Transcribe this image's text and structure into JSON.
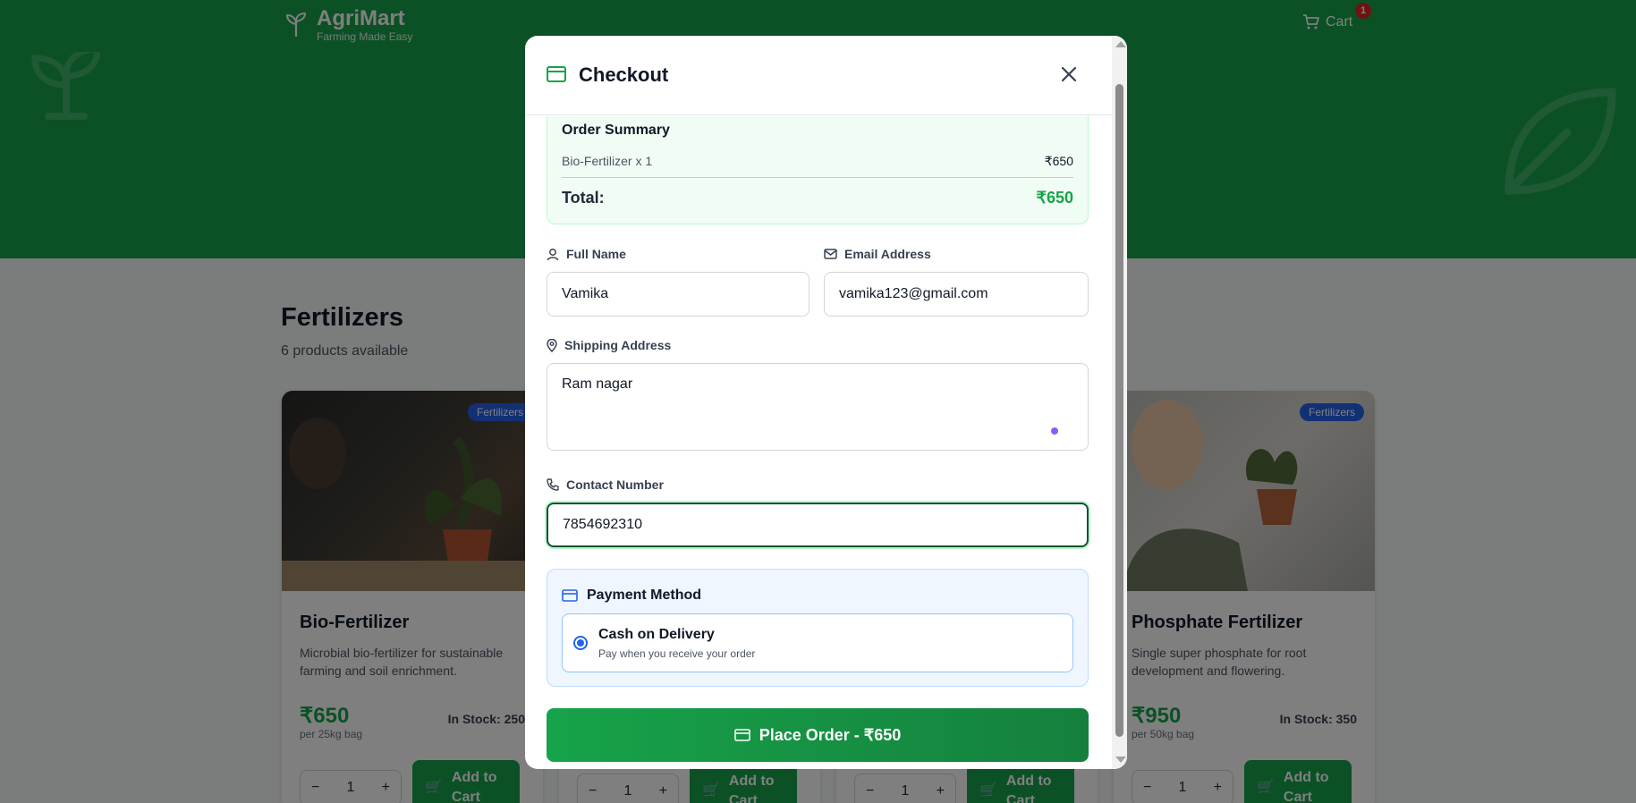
{
  "brand": {
    "name": "AgriMart",
    "tagline": "Farming Made Easy"
  },
  "header": {
    "cart_label": "Cart",
    "cart_count": "1"
  },
  "category": {
    "title": "Fertilizers",
    "count_text": "6 products available"
  },
  "products": [
    {
      "badge": "Fertilizers",
      "name": "Bio-Fertilizer",
      "description": "Microbial bio-fertilizer for sustainable farming and soil enrichment.",
      "price": "₹650",
      "unit": "per 25kg bag",
      "stock": "In Stock: 250",
      "qty": "1",
      "add_label": "Add to Cart"
    },
    {
      "badge": "Fertilizers",
      "name": "Phosphate Fertilizer",
      "description": "Single super phosphate for root development and flowering.",
      "price": "₹950",
      "unit": "per 50kg bag",
      "stock": "In Stock: 350",
      "qty": "1",
      "add_label": "Add to Cart"
    }
  ],
  "hidden_cards": [
    {
      "qty": "1",
      "add_label": "Add to Cart"
    },
    {
      "qty": "1",
      "add_label": "Add to Cart"
    }
  ],
  "checkout": {
    "title": "Checkout",
    "summary": {
      "title": "Order Summary",
      "item": "Bio-Fertilizer x 1",
      "item_price": "₹650",
      "total_label": "Total:",
      "total_amount": "₹650"
    },
    "full_name": {
      "label": "Full Name",
      "value": "Vamika"
    },
    "email": {
      "label": "Email Address",
      "value": "vamika123@gmail.com"
    },
    "address": {
      "label": "Shipping Address",
      "value": "Ram nagar"
    },
    "contact": {
      "label": "Contact Number",
      "value": "7854692310"
    },
    "payment": {
      "title": "Payment Method",
      "option_label": "Cash on Delivery",
      "option_sub": "Pay when you receive your order"
    },
    "place_order_label": "Place Order - ₹650"
  },
  "colors": {
    "primary": "#16a34a",
    "summary_bg": "#f0fdf4",
    "payment_bg": "#eff6ff",
    "badge": "#2563eb"
  }
}
